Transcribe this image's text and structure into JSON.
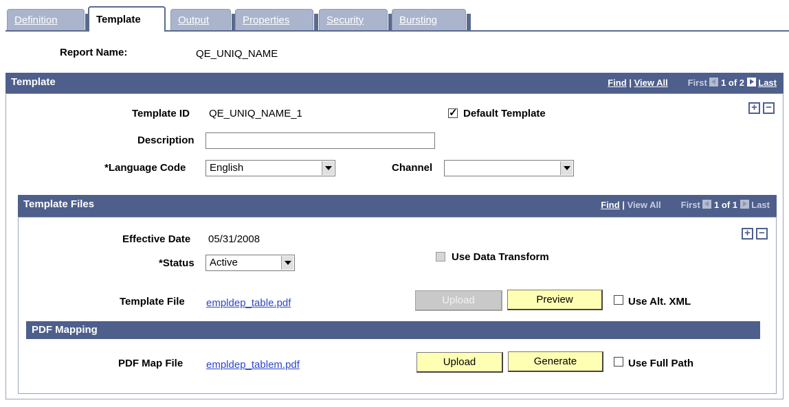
{
  "tabs": [
    {
      "label": "Definition",
      "active": false
    },
    {
      "label": "Template",
      "active": true
    },
    {
      "label": "Output",
      "active": false
    },
    {
      "label": "Properties",
      "active": false
    },
    {
      "label": "Security",
      "active": false
    },
    {
      "label": "Bursting",
      "active": false
    }
  ],
  "report": {
    "name_label": "Report Name:",
    "name_value": "QE_UNIQ_NAME"
  },
  "template_section": {
    "title": "Template",
    "nav": {
      "find": "Find",
      "sep": "|",
      "view_all": "View All",
      "first": "First",
      "count": "1 of 2",
      "last": "Last"
    },
    "template_id_label": "Template ID",
    "template_id_value": "QE_UNIQ_NAME_1",
    "default_template_label": "Default Template",
    "default_template_checked": true,
    "description_label": "Description",
    "description_value": "",
    "language_label": "*Language Code",
    "language_value": "English",
    "channel_label": "Channel",
    "channel_value": "",
    "add_symbol": "+",
    "remove_symbol": "−"
  },
  "files_section": {
    "title": "Template Files",
    "nav": {
      "find": "Find",
      "sep": "|",
      "view_all": "View All",
      "first": "First",
      "count": "1 of 1",
      "last": "Last"
    },
    "effective_date_label": "Effective Date",
    "effective_date_value": "05/31/2008",
    "status_label": "*Status",
    "status_value": "Active",
    "use_data_transform_label": "Use Data Transform",
    "template_file_label": "Template File",
    "template_file_value": "empldep_table.pdf",
    "upload_label": "Upload",
    "preview_label": "Preview",
    "use_alt_xml_label": "Use Alt. XML",
    "add_symbol": "+",
    "remove_symbol": "−"
  },
  "pdf_mapping": {
    "title": "PDF Mapping",
    "map_file_label": "PDF Map File",
    "map_file_value": "empldep_tablem.pdf",
    "upload_label": "Upload",
    "generate_label": "Generate",
    "use_full_path_label": "Use Full Path"
  },
  "colors": {
    "header_bar": "#4e5f8c",
    "button": "#ffffb3",
    "link": "#2a46c8",
    "inactive_tab": "#aab4cc"
  }
}
